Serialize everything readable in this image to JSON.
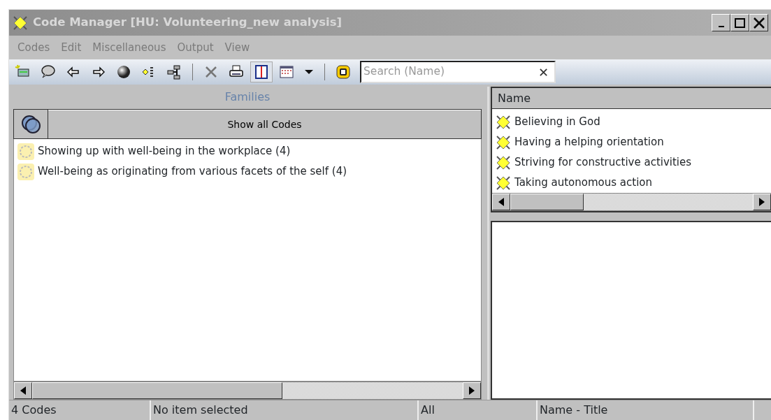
{
  "window": {
    "title": "Code Manager [HU: Volunteering_new analysis]"
  },
  "menu": [
    "Codes",
    "Edit",
    "Miscellaneous",
    "Output",
    "View"
  ],
  "toolbar": [
    {
      "kind": "button",
      "pressed": false
    },
    {
      "kind": "button",
      "pressed": false
    },
    {
      "kind": "button",
      "pressed": false
    },
    {
      "kind": "button",
      "pressed": false
    },
    {
      "kind": "button",
      "pressed": false
    },
    {
      "kind": "button",
      "pressed": false
    },
    {
      "kind": "button",
      "pressed": false
    },
    {
      "kind": "separator"
    },
    {
      "kind": "button",
      "pressed": false
    },
    {
      "kind": "button",
      "pressed": false
    },
    {
      "kind": "button",
      "pressed": true
    },
    {
      "kind": "button",
      "pressed": false
    },
    {
      "kind": "dropdown"
    },
    {
      "kind": "separator"
    },
    {
      "kind": "button",
      "pressed": false
    }
  ],
  "search": {
    "placeholder": "Search (Name)",
    "clear": "✕"
  },
  "families": {
    "title": "Families",
    "show_all": "Show all Codes",
    "items": [
      {
        "label": "Showing up with well-being in the workplace (4)"
      },
      {
        "label": "Well-being as originating from various facets of the self (4)"
      }
    ]
  },
  "codes": {
    "column": "Name",
    "items": [
      {
        "label": "Believing in God"
      },
      {
        "label": "Having a helping orientation"
      },
      {
        "label": "Striving for constructive activities"
      },
      {
        "label": "Taking autonomous action"
      }
    ]
  },
  "status_bar": [
    "4 Codes",
    "No item selected",
    "All",
    "Name - Title"
  ]
}
